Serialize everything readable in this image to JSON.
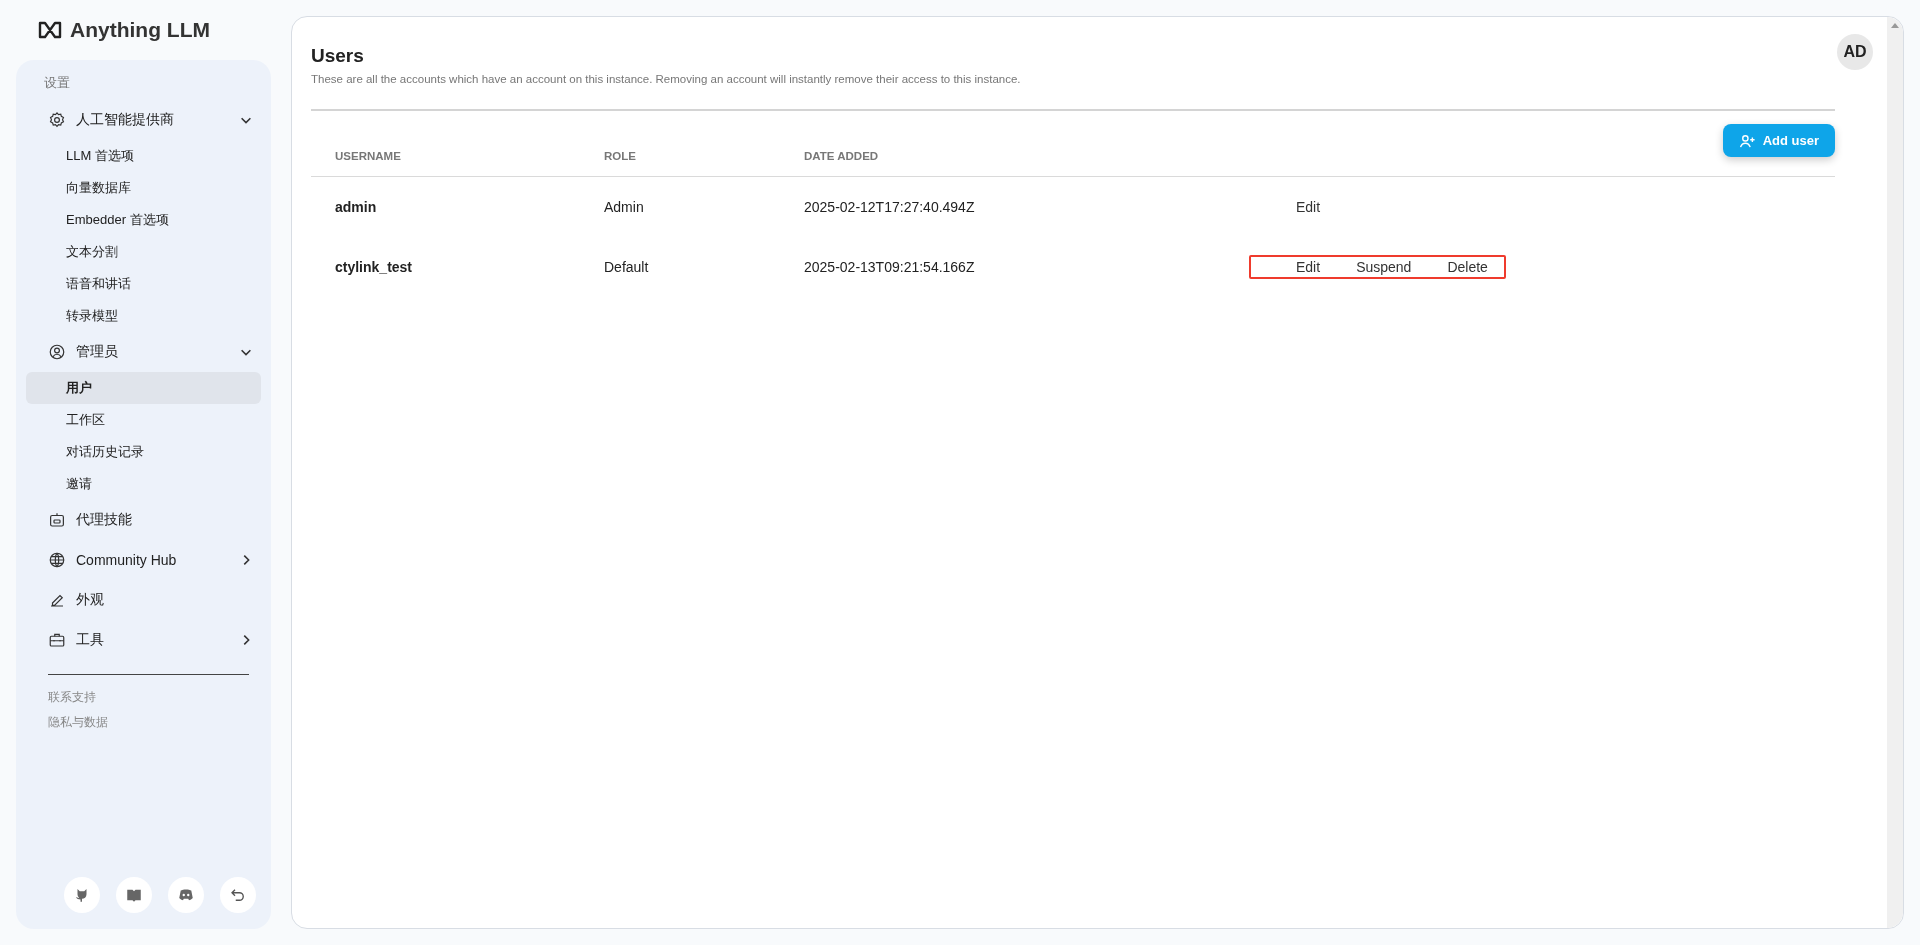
{
  "brand": {
    "name": "Anything LLM"
  },
  "sidebar": {
    "section_label": "设置",
    "items": [
      {
        "kind": "group",
        "label": "人工智能提供商",
        "expanded": true,
        "children": [
          {
            "label": "LLM 首选项",
            "selected": false
          },
          {
            "label": "向量数据库",
            "selected": false
          },
          {
            "label": "Embedder 首选项",
            "selected": false
          },
          {
            "label": "文本分割",
            "selected": false
          },
          {
            "label": "语音和讲话",
            "selected": false
          },
          {
            "label": "转录模型",
            "selected": false
          }
        ]
      },
      {
        "kind": "group",
        "label": "管理员",
        "expanded": true,
        "children": [
          {
            "label": "用户",
            "selected": true
          },
          {
            "label": "工作区",
            "selected": false
          },
          {
            "label": "对话历史记录",
            "selected": false
          },
          {
            "label": "邀请",
            "selected": false
          }
        ]
      },
      {
        "kind": "link",
        "label": "代理技能"
      },
      {
        "kind": "group",
        "label": "Community Hub",
        "expanded": false
      },
      {
        "kind": "link",
        "label": "外观"
      },
      {
        "kind": "group",
        "label": "工具",
        "expanded": false
      }
    ],
    "footer_links": [
      "联系支持",
      "隐私与数据"
    ]
  },
  "header": {
    "avatar": "AD"
  },
  "page": {
    "title": "Users",
    "description": "These are all the accounts which have an account on this instance. Removing an account will instantly remove their access to this instance.",
    "add_button": "Add user"
  },
  "table": {
    "columns": [
      "USERNAME",
      "ROLE",
      "DATE ADDED"
    ],
    "rows": [
      {
        "username": "admin",
        "role": "Admin",
        "date_added": "2025-02-12T17:27:40.494Z",
        "actions": [
          "Edit"
        ],
        "highlighted": false
      },
      {
        "username": "ctylink_test",
        "role": "Default",
        "date_added": "2025-02-13T09:21:54.166Z",
        "actions": [
          "Edit",
          "Suspend",
          "Delete"
        ],
        "highlighted": true
      }
    ]
  }
}
